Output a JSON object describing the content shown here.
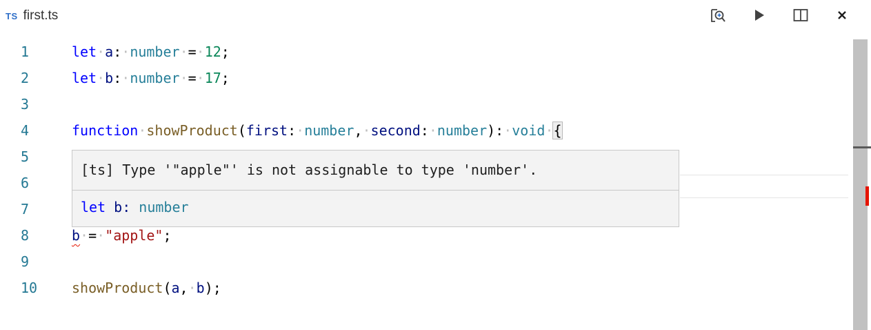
{
  "tab": {
    "badge": "TS",
    "title": "first.ts"
  },
  "actions": [
    {
      "name": "open-changes-icon"
    },
    {
      "name": "run-icon"
    },
    {
      "name": "split-editor-icon"
    },
    {
      "name": "close-icon"
    }
  ],
  "editor": {
    "lines": [
      {
        "num": "1",
        "tokens": [
          [
            "kw",
            "let"
          ],
          [
            "ws",
            "·"
          ],
          [
            "var",
            "a"
          ],
          [
            "punc",
            ":"
          ],
          [
            "ws",
            "·"
          ],
          [
            "ty",
            "number"
          ],
          [
            "ws",
            "·"
          ],
          [
            "punc",
            "="
          ],
          [
            "ws",
            "·"
          ],
          [
            "num",
            "12"
          ],
          [
            "punc",
            ";"
          ]
        ]
      },
      {
        "num": "2",
        "tokens": [
          [
            "kw",
            "let"
          ],
          [
            "ws",
            "·"
          ],
          [
            "var",
            "b"
          ],
          [
            "punc",
            ":"
          ],
          [
            "ws",
            "·"
          ],
          [
            "ty",
            "number"
          ],
          [
            "ws",
            "·"
          ],
          [
            "punc",
            "="
          ],
          [
            "ws",
            "·"
          ],
          [
            "num",
            "17"
          ],
          [
            "punc",
            ";"
          ]
        ]
      },
      {
        "num": "3",
        "tokens": []
      },
      {
        "num": "4",
        "tokens": [
          [
            "kw",
            "function"
          ],
          [
            "ws",
            "·"
          ],
          [
            "fn",
            "showProduct"
          ],
          [
            "punc",
            "("
          ],
          [
            "var",
            "first"
          ],
          [
            "punc",
            ":"
          ],
          [
            "ws",
            "·"
          ],
          [
            "ty",
            "number"
          ],
          [
            "punc",
            ","
          ],
          [
            "ws",
            "·"
          ],
          [
            "var",
            "second"
          ],
          [
            "punc",
            ":"
          ],
          [
            "ws",
            "·"
          ],
          [
            "ty",
            "number"
          ],
          [
            "punc",
            "):"
          ],
          [
            "ws",
            "·"
          ],
          [
            "ty",
            "void"
          ],
          [
            "ws",
            "·"
          ],
          [
            "brace",
            "{"
          ]
        ]
      },
      {
        "num": "5",
        "tokens": []
      },
      {
        "num": "6",
        "tokens": []
      },
      {
        "num": "7",
        "tokens": []
      },
      {
        "num": "8",
        "tokens": [
          [
            "err",
            "b"
          ],
          [
            "ws",
            "·"
          ],
          [
            "punc",
            "="
          ],
          [
            "ws",
            "·"
          ],
          [
            "str",
            "\"apple\""
          ],
          [
            "punc",
            ";"
          ]
        ]
      },
      {
        "num": "9",
        "tokens": []
      },
      {
        "num": "10",
        "tokens": [
          [
            "fn",
            "showProduct"
          ],
          [
            "punc",
            "("
          ],
          [
            "var",
            "a"
          ],
          [
            "punc",
            ","
          ],
          [
            "ws",
            "·"
          ],
          [
            "var",
            "b"
          ],
          [
            "punc",
            ");"
          ]
        ]
      }
    ]
  },
  "hover": {
    "message": "[ts] Type '\"apple\"' is not assignable to type 'number'.",
    "signature_keyword": "let",
    "signature_name": " b: ",
    "signature_type": "number"
  }
}
